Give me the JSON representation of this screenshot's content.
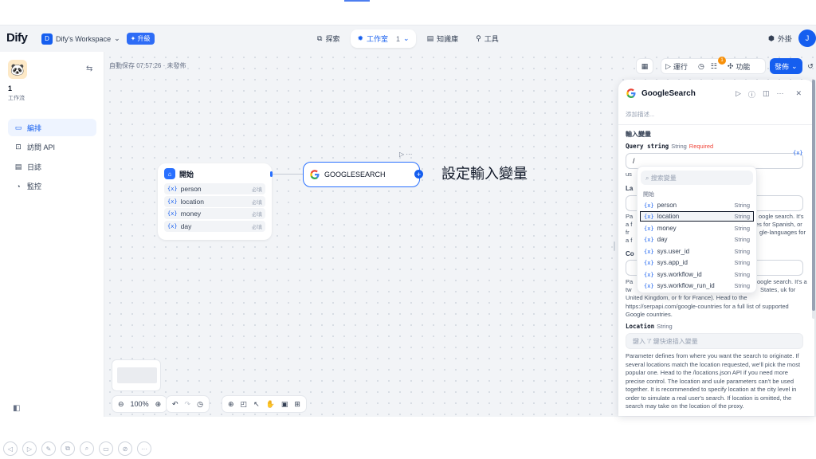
{
  "nav": {
    "logo": "Dify",
    "workspace_initial": "D",
    "workspace_name": "Dify's Workspace",
    "upgrade": "✦ 升級",
    "center": [
      {
        "name": "explore",
        "icon": "⧉",
        "label": "探索"
      },
      {
        "name": "studio",
        "icon": "✹",
        "label": "工作室",
        "count": "1"
      },
      {
        "name": "knowledge",
        "icon": "▤",
        "label": "知識庫"
      },
      {
        "name": "tools",
        "icon": "⚲",
        "label": "工具"
      }
    ],
    "plugins": "外掛",
    "user_initial": "J"
  },
  "sidebar": {
    "app_name": "1",
    "app_type": "工作流",
    "items": [
      {
        "icon": "▭",
        "label": "編排"
      },
      {
        "icon": "⊡",
        "label": "訪問 API"
      },
      {
        "icon": "▤",
        "label": "日誌"
      },
      {
        "icon": "◔",
        "label": "監控"
      }
    ]
  },
  "canvas": {
    "autosave": "自動保存 07:57:26 · 未發佈",
    "toolbar": {
      "run": "運行",
      "features": "功能",
      "publish": "發佈",
      "badge_count": "1"
    },
    "zoom": "100%",
    "annotation": "設定輸入變量"
  },
  "start_node": {
    "title": "開始",
    "vars": [
      {
        "name": "person",
        "req": "必填"
      },
      {
        "name": "location",
        "req": "必填"
      },
      {
        "name": "money",
        "req": "必填"
      },
      {
        "name": "day",
        "req": "必填"
      }
    ]
  },
  "google_node": {
    "title": "GOOGLESEARCH"
  },
  "panel": {
    "title": "GoogleSearch",
    "desc_placeholder": "添加描述...",
    "section": "輸入變量",
    "query": {
      "name": "Query string",
      "type": "String",
      "required": "Required",
      "value": "/"
    },
    "frag_us": "us",
    "frag_la": "La",
    "lang_frag_1a": "Pa",
    "lang_frag_1b": "oogle search. It's",
    "lang_frag_2a": "a f",
    "lang_frag_2b": "es for Spanish, or",
    "lang_frag_3a": "fr",
    "lang_frag_3b": "gle-languages for",
    "lang_frag_4": "a f",
    "frag_co": "Co",
    "country_frag_1a": "Pa",
    "country_frag_1b": "oogle search. It's a",
    "country_frag_2a": "tw",
    "country_frag_2b": "States, uk for",
    "country_text": "United Kingdom, or fr for France). Head to the https://serpapi.com/google-countries for a full list of supported Google countries.",
    "location": {
      "name": "Location",
      "type": "String",
      "placeholder": "鍵入 '/' 鍵快速插入變量"
    },
    "location_text": "Parameter defines from where you want the search to originate. If several locations match the location requested, we'll pick the most popular one. Head to the /locations.json API if you need more precise control. The location and uule parameters can't be used together. It is recommended to specify location at the city level in order to simulate a real user's search. If location is omitted, the search may take on the location of the proxy."
  },
  "dropdown": {
    "search_placeholder": "搜索變量",
    "group": "開始",
    "items": [
      {
        "name": "person",
        "type": "String"
      },
      {
        "name": "location",
        "type": "String"
      },
      {
        "name": "money",
        "type": "String"
      },
      {
        "name": "day",
        "type": "String"
      },
      {
        "name": "sys.user_id",
        "type": "String"
      },
      {
        "name": "sys.app_id",
        "type": "String"
      },
      {
        "name": "sys.workflow_id",
        "type": "String"
      },
      {
        "name": "sys.workflow_run_id",
        "type": "String"
      }
    ]
  },
  "colors": {
    "accent": "#155eef",
    "required": "#f04438",
    "badge": "#f79009"
  }
}
